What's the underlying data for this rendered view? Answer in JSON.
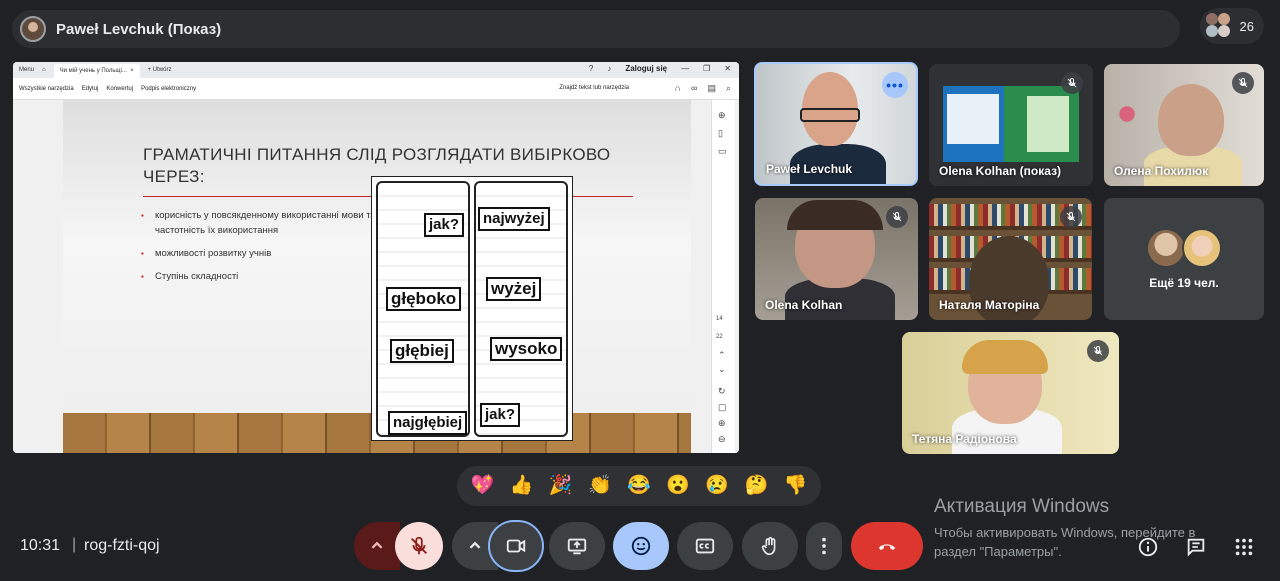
{
  "meeting": {
    "presenter_title": "Paweł Levchuk (Показ)",
    "participant_count": "26",
    "time": "10:31",
    "separator": "|",
    "code": "rog-fzti-qoj"
  },
  "shared_screen": {
    "tabs": {
      "menu": "Menu",
      "active_tab": "Чи мій учень у Польщі...",
      "new_tab": "+ Utwórz",
      "login": "Zaloguj się"
    },
    "menu_items": [
      "Wszystkie narzędzia",
      "Edytuj",
      "Konwertuj",
      "Podpis elektroniczny"
    ],
    "find_text": "Znajdź tekst lub narzędzia",
    "page_numbers": [
      "14",
      "22"
    ],
    "slide": {
      "title": "ГРАМАТИЧНІ ПИТАННЯ СЛІД РОЗГЛЯДАТИ ВИБІРКОВО ЧЕРЕЗ:",
      "bullets": [
        "корисність у повсякденному використанні мови та частотність їх використання",
        "можливості розвитку учнів",
        "Ступінь складності"
      ],
      "comic_left": [
        "jak?",
        "głęboko",
        "głębiej",
        "najgłębiej"
      ],
      "comic_right": [
        "najwyżej",
        "wyżej",
        "wysoko",
        "jak?"
      ]
    }
  },
  "participants": [
    {
      "name": "Paweł Levchuk"
    },
    {
      "name": "Olena Kolhan (показ)"
    },
    {
      "name": "Олена Похилюк"
    },
    {
      "name": "Olena Kolhan"
    },
    {
      "name": "Наталя Маторіна"
    },
    {
      "name": "Ещё 19 чел."
    },
    {
      "name": "Тетяна Радіонова"
    }
  ],
  "reactions": [
    "💖",
    "👍",
    "🎉",
    "👏",
    "😂",
    "😮",
    "😢",
    "🤔",
    "👎"
  ],
  "windows_activation": {
    "title": "Активация Windows",
    "line1": "Чтобы активировать Windows, перейдите в",
    "line2": "раздел \"Параметры\"."
  },
  "colors": {
    "background": "#202124",
    "hangup": "#dc362e",
    "accent": "#a8c7fa",
    "mic_off_bg": "#f9dedc"
  }
}
